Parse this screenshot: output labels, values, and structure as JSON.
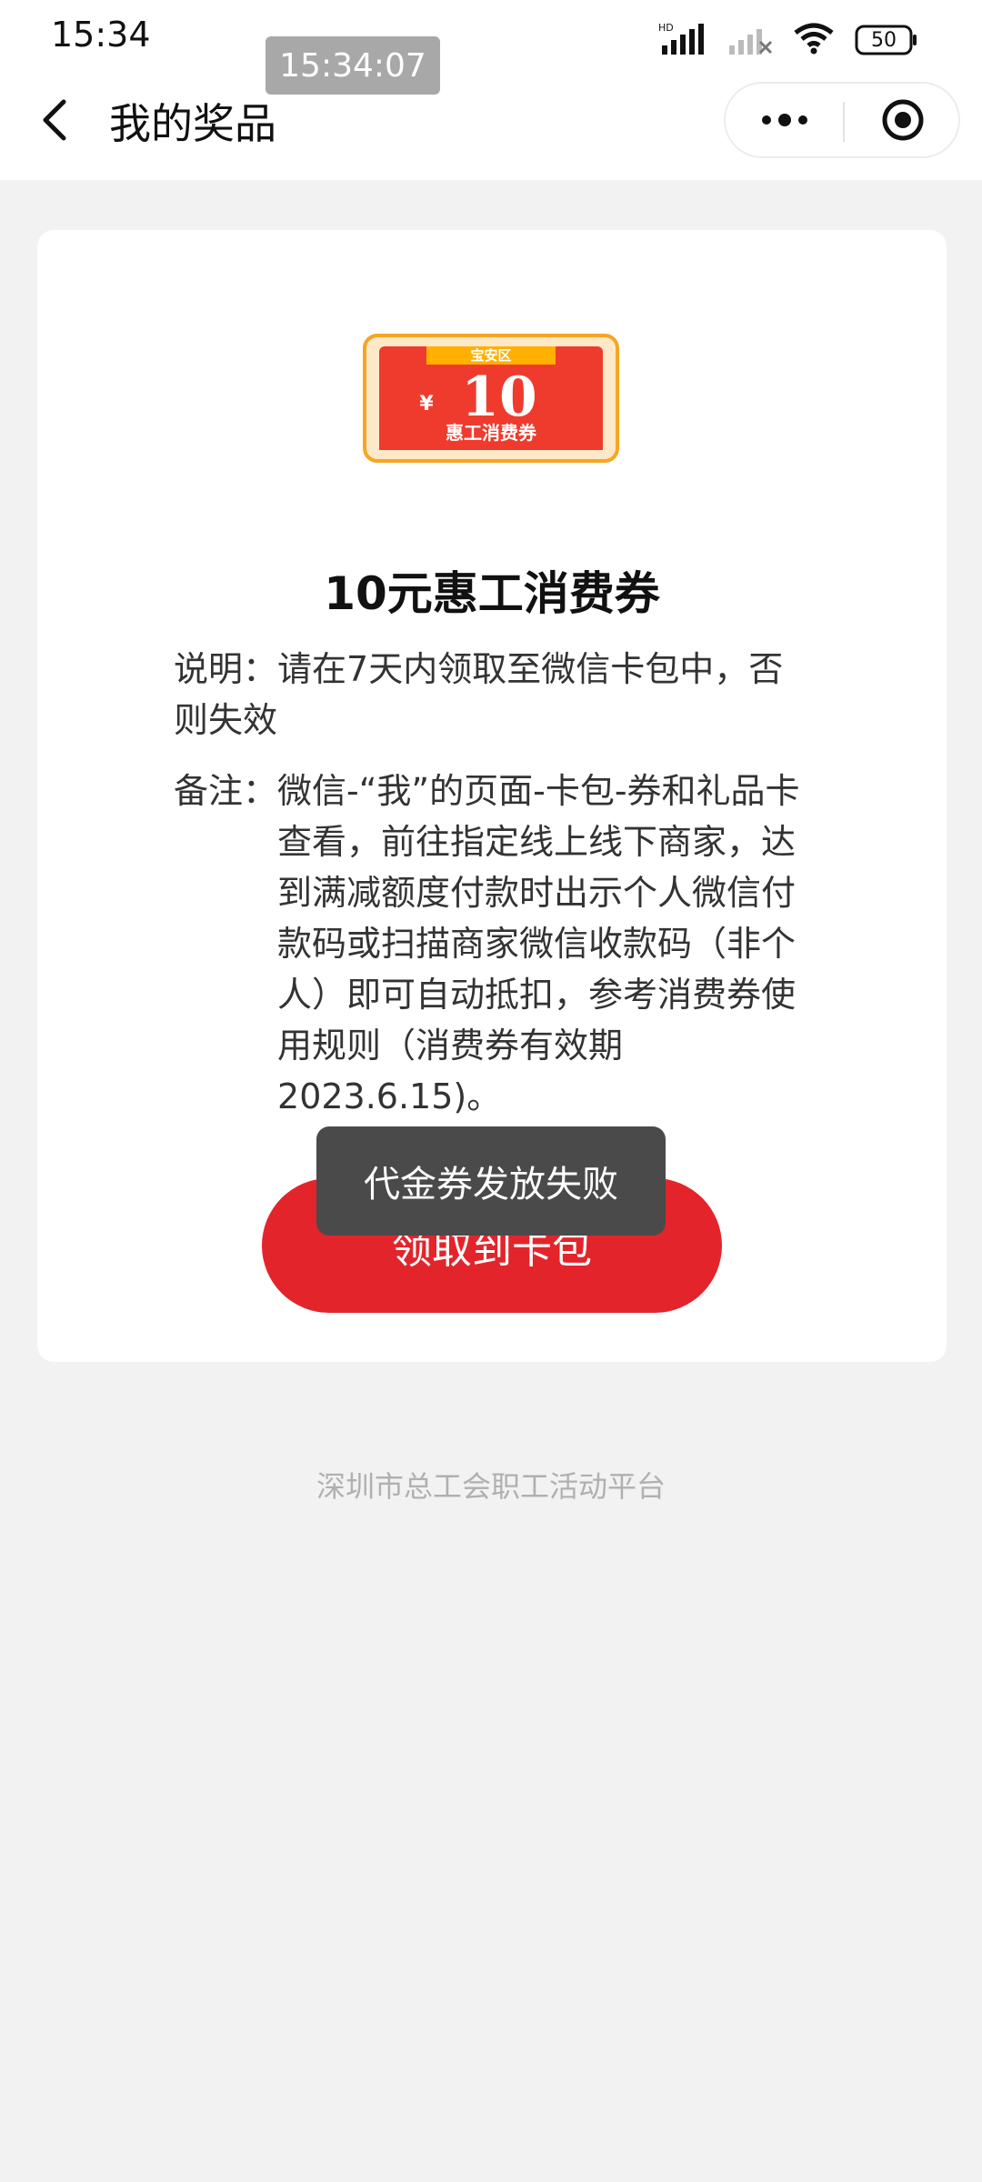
{
  "status_bar": {
    "time": "15:34",
    "network_label": "HD",
    "battery": "50",
    "overlay_time": "15:34:07"
  },
  "nav": {
    "title": "我的奖品"
  },
  "coupon": {
    "district": "宝安区",
    "currency": "¥",
    "amount": "10",
    "name": "惠工消费券",
    "colors": {
      "outer": "#f5a623",
      "inner": "#ef3b2d",
      "band": "#ffb000"
    }
  },
  "prize": {
    "title": "10元惠工消费券",
    "description_label": "说明：",
    "description": "请在7天内领取至微信卡包中，否则失效",
    "note_label": "备注：",
    "note": "微信-“我”的页面-卡包-券和礼品卡查看，前往指定线上线下商家，达到满减额度付款时出示个人微信付款码或扫描商家微信收款码（非个人）即可自动抵扣，参考消费券使用规则（消费券有效期2023.6.15)。",
    "claim_button": "领取到卡包"
  },
  "toast": {
    "message": "代金券发放失败"
  },
  "footer": {
    "text": "深圳市总工会职工活动平台"
  },
  "theme": {
    "accent": "#e3242b",
    "toast_bg": "#4a4a4a",
    "page_bg": "#f2f2f2"
  }
}
